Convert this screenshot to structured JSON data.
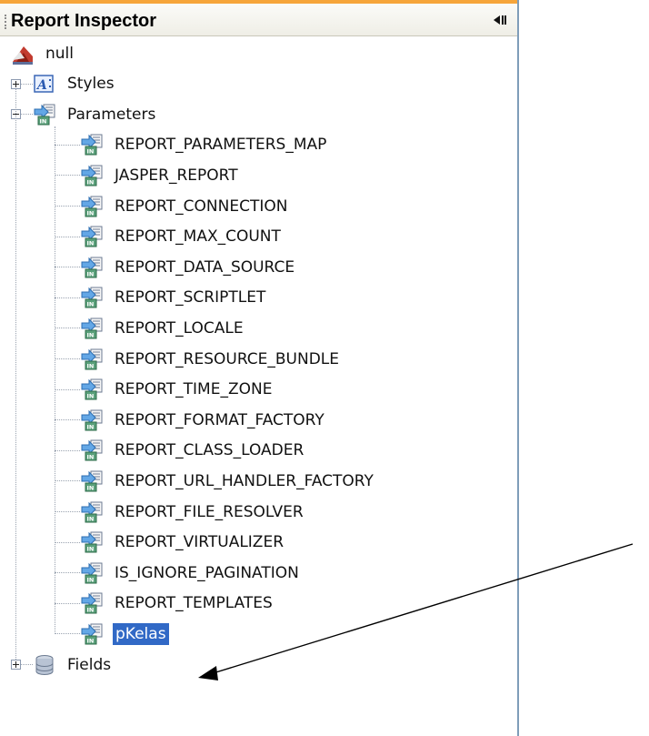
{
  "panel": {
    "title": "Report Inspector"
  },
  "tree": {
    "root": {
      "label": "null",
      "icon": "report-icon"
    },
    "styles": {
      "label": "Styles",
      "icon": "styles-icon",
      "expanded": false
    },
    "parameters": {
      "label": "Parameters",
      "icon": "parameter-icon",
      "expanded": true
    },
    "parameter_items": [
      "REPORT_PARAMETERS_MAP",
      "JASPER_REPORT",
      "REPORT_CONNECTION",
      "REPORT_MAX_COUNT",
      "REPORT_DATA_SOURCE",
      "REPORT_SCRIPTLET",
      "REPORT_LOCALE",
      "REPORT_RESOURCE_BUNDLE",
      "REPORT_TIME_ZONE",
      "REPORT_FORMAT_FACTORY",
      "REPORT_CLASS_LOADER",
      "REPORT_URL_HANDLER_FACTORY",
      "REPORT_FILE_RESOLVER",
      "REPORT_VIRTUALIZER",
      "IS_IGNORE_PAGINATION",
      "REPORT_TEMPLATES",
      "pKelas"
    ],
    "selected_item": "pKelas",
    "fields": {
      "label": "Fields",
      "icon": "database-icon",
      "expanded": false
    }
  },
  "colors": {
    "selection": "#3169c6",
    "header_accent": "#f6a53a",
    "arrow": "#000000"
  },
  "annotation": {
    "type": "arrow",
    "points_to": "pKelas"
  }
}
